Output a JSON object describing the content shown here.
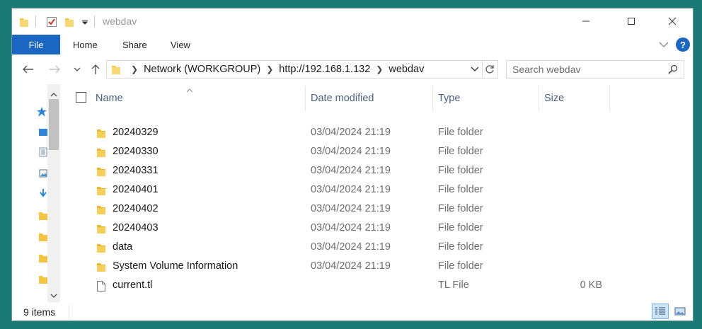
{
  "window": {
    "title": "webdav"
  },
  "ribbon": {
    "tabs": {
      "file": "File",
      "home": "Home",
      "share": "Share",
      "view": "View"
    },
    "help": "?"
  },
  "nav": {
    "breadcrumbs": [
      "Network (WORKGROUP)",
      "http://192.168.1.132",
      "webdav"
    ]
  },
  "search": {
    "placeholder": "Search webdav"
  },
  "columns": {
    "name": "Name",
    "date": "Date modified",
    "type": "Type",
    "size": "Size"
  },
  "files": [
    {
      "name": "20240329",
      "date": "03/04/2024 21:19",
      "type": "File folder",
      "size": "",
      "icon": "folder-icon"
    },
    {
      "name": "20240330",
      "date": "03/04/2024 21:19",
      "type": "File folder",
      "size": "",
      "icon": "folder-icon"
    },
    {
      "name": "20240331",
      "date": "03/04/2024 21:19",
      "type": "File folder",
      "size": "",
      "icon": "folder-icon"
    },
    {
      "name": "20240401",
      "date": "03/04/2024 21:19",
      "type": "File folder",
      "size": "",
      "icon": "folder-icon"
    },
    {
      "name": "20240402",
      "date": "03/04/2024 21:19",
      "type": "File folder",
      "size": "",
      "icon": "folder-icon"
    },
    {
      "name": "20240403",
      "date": "03/04/2024 21:19",
      "type": "File folder",
      "size": "",
      "icon": "folder-icon"
    },
    {
      "name": "data",
      "date": "03/04/2024 21:19",
      "type": "File folder",
      "size": "",
      "icon": "folder-icon"
    },
    {
      "name": "System Volume Information",
      "date": "03/04/2024 21:19",
      "type": "File folder",
      "size": "",
      "icon": "folder-icon"
    },
    {
      "name": "current.tl",
      "date": "",
      "type": "TL File",
      "size": "0 KB",
      "icon": "file-icon"
    }
  ],
  "status": {
    "count": "9 items"
  },
  "colors": {
    "accent": "#1a66c0",
    "folder": "#f3c542",
    "desktop": "#1c7a76"
  }
}
